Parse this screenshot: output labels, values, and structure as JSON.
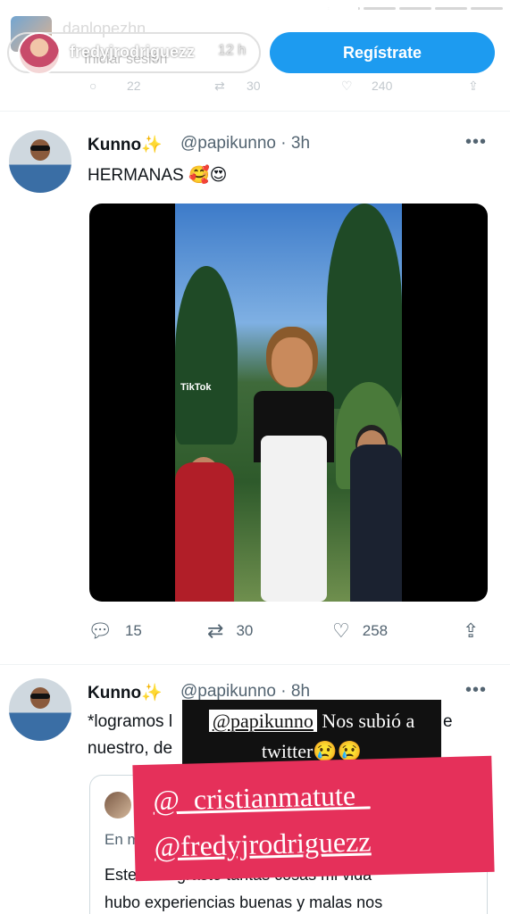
{
  "story": {
    "progress": [
      1,
      1,
      1,
      1,
      1,
      1,
      1,
      1,
      1,
      0.95,
      0,
      0,
      0,
      0
    ],
    "background_user": "danlopezhn",
    "username": "fredyjrodriguezz",
    "time": "12 h",
    "login_hint": "Iniciar sesión"
  },
  "header": {
    "signup_label": "Regístrate"
  },
  "prev_actions": {
    "reply": "22",
    "retweet": "30",
    "like": "240"
  },
  "tweets": [
    {
      "name": "Kunno",
      "name_emoji": "✨",
      "handle": "@papikunno",
      "sep": "·",
      "time": "3h",
      "text": "HERMANAS 🥰😍",
      "media_watermark": "TikTok",
      "replies": "15",
      "retweets": "30",
      "likes": "258"
    },
    {
      "name": "Kunno",
      "name_emoji": "✨",
      "handle": "@papikunno",
      "sep": "·",
      "time": "8h",
      "text_line1": "*logramos l",
      "text_line1_end": "e",
      "text_line2": "nuestro, de",
      "quote": {
        "label": "En m",
        "line1": "Este         graste tantas cosas mi vida",
        "line2": "hubo experiencias buenas y malas nos"
      }
    }
  ],
  "stickers": {
    "dark_mention": "@papikunno",
    "dark_text1": " Nos subió a",
    "dark_text2": "twitter😢😢",
    "red_line1": "@_cristianmatute_",
    "red_line2": "@fredyjrodriguezz"
  }
}
